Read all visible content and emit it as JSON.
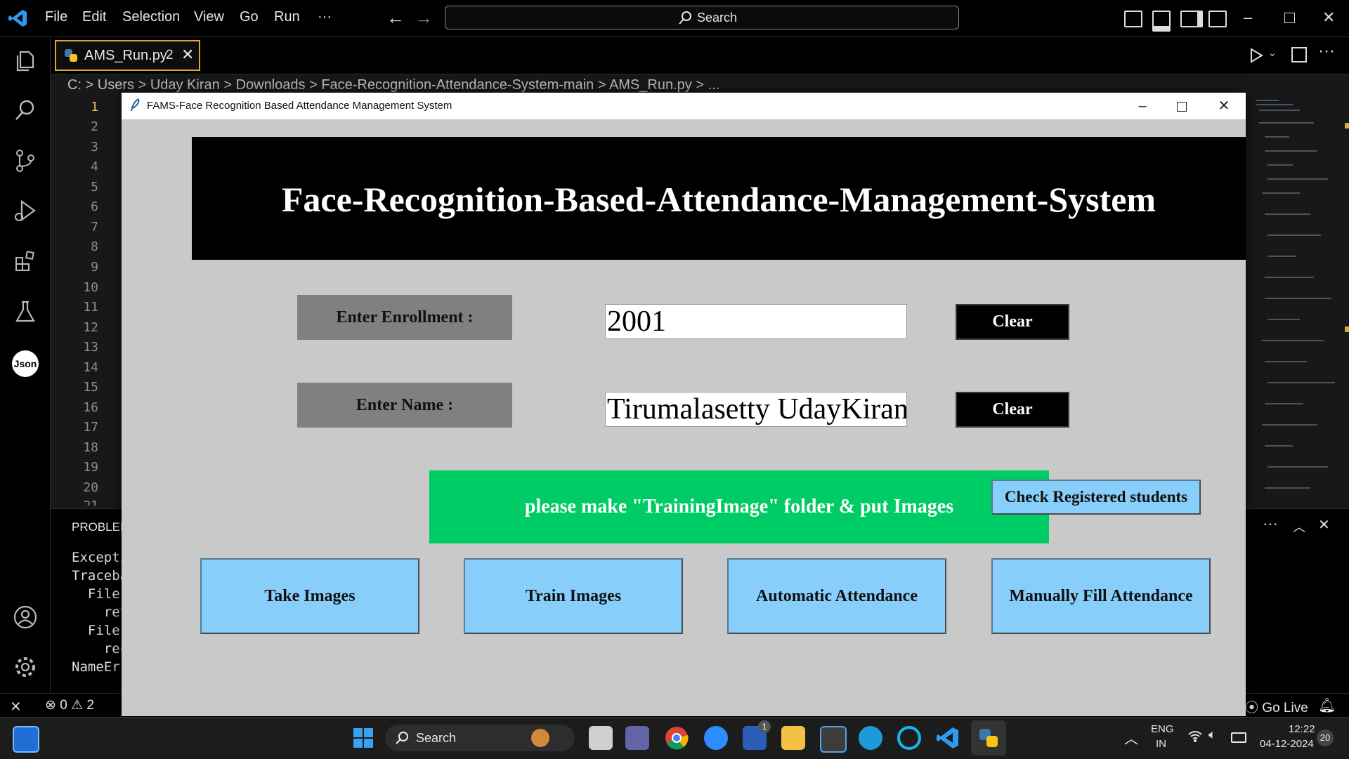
{
  "vscode": {
    "menu": [
      "File",
      "Edit",
      "Selection",
      "View",
      "Go",
      "Run",
      "···"
    ],
    "search_label": "Search",
    "tab": {
      "filename": "AMS_Run.py",
      "problems_count": "2"
    },
    "breadcrumb": [
      "C:",
      "Users",
      "Uday Kiran",
      "Downloads",
      "Face-Recognition-Attendance-System-main",
      "AMS_Run.py",
      "..."
    ],
    "line_numbers": [
      "1",
      "2",
      "3",
      "4",
      "5",
      "6",
      "7",
      "8",
      "9",
      "10",
      "11",
      "12",
      "13",
      "14",
      "15",
      "16",
      "17",
      "18",
      "19",
      "20",
      "21"
    ],
    "panel": {
      "tab_label": "PROBLEM",
      "lines": [
        "Excepti",
        "Traceba",
        "  File",
        "    ret",
        "  File",
        "    rec",
        "NameErr"
      ]
    },
    "status": {
      "errors": "0",
      "warnings": "2",
      "go_live": "Go Live"
    }
  },
  "tk_window": {
    "title": "FAMS-Face Recognition Based Attendance Management System",
    "heading": "Face-Recognition-Based-Attendance-Management-System",
    "enrollment_label": "Enter Enrollment :",
    "enrollment_value": "2001",
    "name_label": "Enter Name :",
    "name_value": "Tirumalasetty UdayKiran",
    "clear_label": "Clear",
    "notification": "please make \"TrainingImage\" folder & put Images",
    "check_registered": "Check Registered students",
    "buttons": [
      "Take Images",
      "Train Images",
      "Automatic Attendance",
      "Manually Fill Attendance"
    ]
  },
  "taskbar": {
    "search_label": "Search",
    "lang_top": "ENG",
    "lang_bottom": "IN",
    "time": "12:22",
    "date": "04-12-2024",
    "notification_count": "20",
    "badge_count": "1"
  },
  "colors": {
    "accent_tab": "#e5a33a",
    "tk_bg": "#c9c9c9",
    "notice_green": "#00cc66",
    "button_blue": "#87cefa",
    "label_gray": "#808080"
  },
  "icons": [
    "vscode-logo-icon",
    "explorer-icon",
    "search-icon",
    "source-control-icon",
    "run-debug-icon",
    "extensions-icon",
    "testing-icon",
    "json-icon",
    "account-icon",
    "settings-gear-icon",
    "python-file-icon",
    "tk-feather-icon",
    "windows-start-icon",
    "chrome-icon",
    "edge-icon",
    "zoom-icon",
    "file-explorer-icon",
    "wifi-icon",
    "volume-icon",
    "battery-icon"
  ]
}
